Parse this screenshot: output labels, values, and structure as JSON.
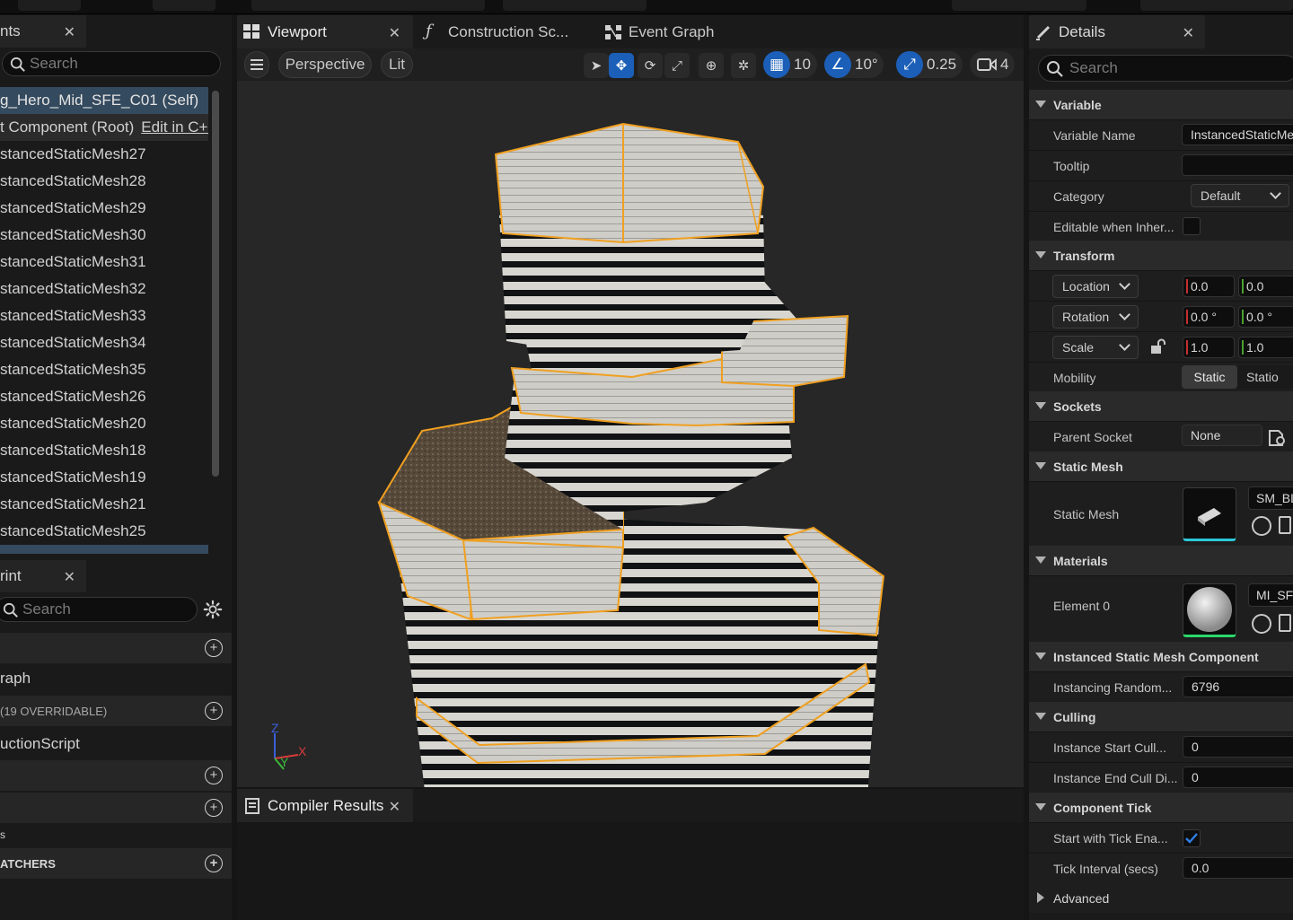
{
  "outliner": {
    "tab_label": "nts",
    "search_placeholder": "Search",
    "items": [
      {
        "label": "g_Hero_Mid_SFE_C01 (Self)"
      },
      {
        "label": "t Component (Root)",
        "edit_link": "Edit in C++"
      },
      {
        "label": "stancedStaticMesh27"
      },
      {
        "label": "stancedStaticMesh28"
      },
      {
        "label": "stancedStaticMesh29"
      },
      {
        "label": "stancedStaticMesh30"
      },
      {
        "label": "stancedStaticMesh31"
      },
      {
        "label": "stancedStaticMesh32"
      },
      {
        "label": "stancedStaticMesh33"
      },
      {
        "label": "stancedStaticMesh34"
      },
      {
        "label": "stancedStaticMesh35"
      },
      {
        "label": "stancedStaticMesh26"
      },
      {
        "label": "stancedStaticMesh20"
      },
      {
        "label": "stancedStaticMesh18"
      },
      {
        "label": "stancedStaticMesh19"
      },
      {
        "label": "stancedStaticMesh21"
      },
      {
        "label": "stancedStaticMesh25"
      }
    ]
  },
  "my_blueprint": {
    "tab_label": "rint",
    "search_placeholder": "Search",
    "rows": [
      {
        "label": "",
        "type": "hdr",
        "plus": true
      },
      {
        "label": "raph",
        "type": "normal",
        "plus": false
      },
      {
        "label": "(19 OVERRIDABLE)",
        "type": "small",
        "plus": true
      },
      {
        "label": "uctionScript",
        "type": "normal",
        "plus": false
      },
      {
        "label": "",
        "type": "hdr",
        "plus": true
      },
      {
        "label": "",
        "type": "hdr",
        "plus": true
      },
      {
        "label": "s",
        "type": "tiny",
        "plus": false
      },
      {
        "label": "ATCHERS",
        "type": "bold",
        "plus": true
      }
    ]
  },
  "center_tabs": [
    {
      "label": "Viewport",
      "icon": "viewport-icon",
      "closable": true
    },
    {
      "label": "Construction Sc...",
      "icon": "function-icon",
      "closable": false
    },
    {
      "label": "Event Graph",
      "icon": "event-graph-icon",
      "closable": false
    }
  ],
  "viewport_toolbar": {
    "perspective": "Perspective",
    "lit": "Lit",
    "grid_snap": "10",
    "rotation_snap": "10°",
    "scale_snap": "0.25",
    "camera_speed": "4"
  },
  "axis_gizmo": {
    "z": "Z",
    "x": "X",
    "y": "Y"
  },
  "compiler": {
    "tab_label": "Compiler Results"
  },
  "details": {
    "tab_label": "Details",
    "search_placeholder": "Search",
    "variable": {
      "header": "Variable",
      "name_label": "Variable Name",
      "name_value": "InstancedStaticMes",
      "tooltip_label": "Tooltip",
      "tooltip_value": "",
      "category_label": "Category",
      "category_value": "Default",
      "editable_label": "Editable when Inher..."
    },
    "transform": {
      "header": "Transform",
      "location_label": "Location",
      "location_x": "0.0",
      "location_y": "0.0",
      "rotation_label": "Rotation",
      "rotation_x": "0.0 °",
      "rotation_y": "0.0 °",
      "scale_label": "Scale",
      "scale_x": "1.0",
      "scale_y": "1.0",
      "mobility_label": "Mobility",
      "mobility_static": "Static",
      "mobility_stationary": "Statio"
    },
    "sockets": {
      "header": "Sockets",
      "parent_label": "Parent Socket",
      "parent_value": "None"
    },
    "static_mesh": {
      "header": "Static Mesh",
      "label": "Static Mesh",
      "asset": "SM_BL"
    },
    "materials": {
      "header": "Materials",
      "element_label": "Element 0",
      "asset": "MI_SFE"
    },
    "ismc": {
      "header": "Instanced Static Mesh Component",
      "random_label": "Instancing Random...",
      "random_value": "6796"
    },
    "culling": {
      "header": "Culling",
      "start_label": "Instance Start Cull...",
      "start_value": "0",
      "end_label": "Instance End Cull Di...",
      "end_value": "0"
    },
    "component_tick": {
      "header": "Component Tick",
      "start_label": "Start with Tick Ena...",
      "interval_label": "Tick Interval (secs)",
      "interval_value": "0.0"
    },
    "advanced": {
      "header": "Advanced"
    }
  },
  "colors": {
    "accent_blue": "#1b5fb8",
    "selection_outline": "#f0a020",
    "panel_bg": "#1a1a1a",
    "viewport_bg": "#272727"
  }
}
